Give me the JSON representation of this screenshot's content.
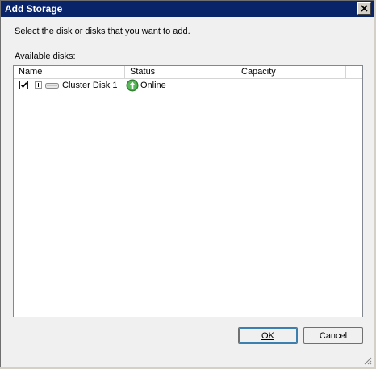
{
  "window": {
    "title": "Add Storage",
    "title_color": "#0a246a",
    "close_glyph": "✕"
  },
  "dialog": {
    "instruction": "Select the disk or disks that you want to add.",
    "available_label": "Available disks:"
  },
  "table": {
    "columns": [
      "Name",
      "Status",
      "Capacity",
      ""
    ],
    "rows": [
      {
        "checked": true,
        "expander": "+",
        "icon": "disk-icon",
        "name": "Cluster Disk 1",
        "status_icon": "online-up-arrow-icon",
        "status": "Online",
        "capacity": ""
      }
    ]
  },
  "buttons": {
    "ok_label": "OK",
    "cancel_label": "Cancel"
  }
}
